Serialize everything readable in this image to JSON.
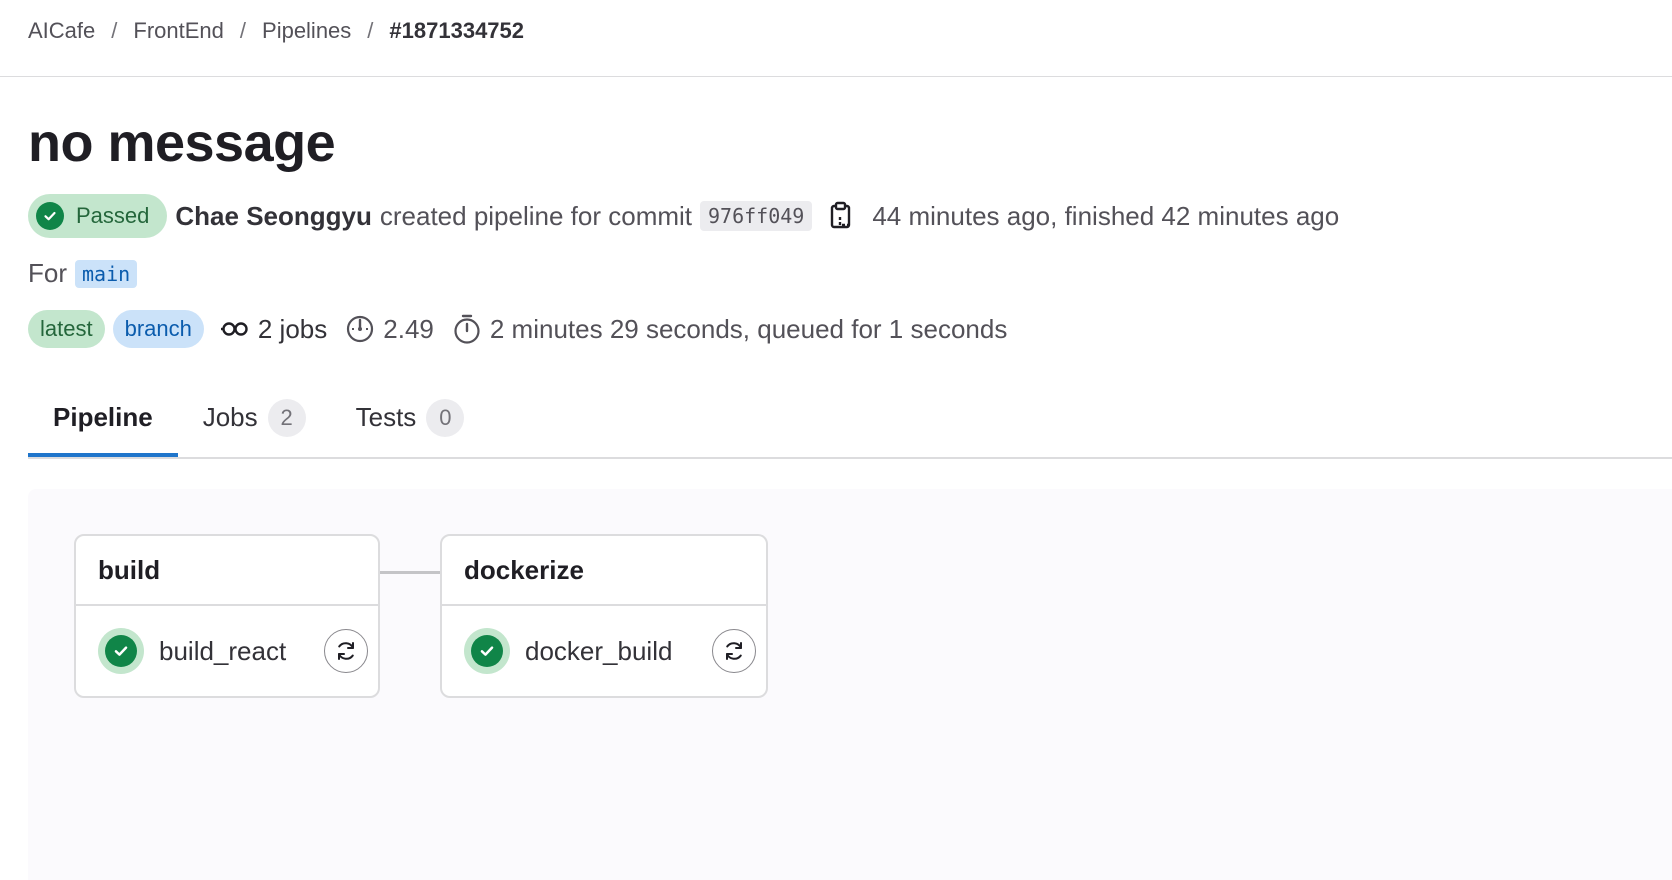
{
  "breadcrumb": {
    "items": [
      "AICafe",
      "FrontEnd",
      "Pipelines"
    ],
    "separator": "/",
    "current": "#1871334752"
  },
  "title": "no message",
  "status": {
    "label": "Passed",
    "color": "#108548"
  },
  "meta": {
    "author": "Chae Seonggyu",
    "action_text": "created pipeline for commit",
    "commit_sha": "976ff049",
    "time_text": "44 minutes ago, finished 42 minutes ago"
  },
  "ref": {
    "prefix": "For",
    "branch": "main"
  },
  "badges": {
    "latest": "latest",
    "branch": "branch",
    "jobs": "2 jobs",
    "compute_minutes": "2.49",
    "duration": "2 minutes 29 seconds, queued for 1 seconds"
  },
  "tabs": [
    {
      "label": "Pipeline",
      "count": null
    },
    {
      "label": "Jobs",
      "count": "2"
    },
    {
      "label": "Tests",
      "count": "0"
    }
  ],
  "stages": [
    {
      "name": "build",
      "jobs": [
        {
          "name": "build_react",
          "status": "success"
        }
      ]
    },
    {
      "name": "dockerize",
      "jobs": [
        {
          "name": "docker_build",
          "status": "success"
        }
      ]
    }
  ],
  "icons": {
    "status": "check-circle-icon",
    "copy": "clipboard-icon",
    "jobs": "pipeline-icon",
    "compute": "gauge-icon",
    "duration": "timer-icon",
    "retry": "retry-icon"
  }
}
